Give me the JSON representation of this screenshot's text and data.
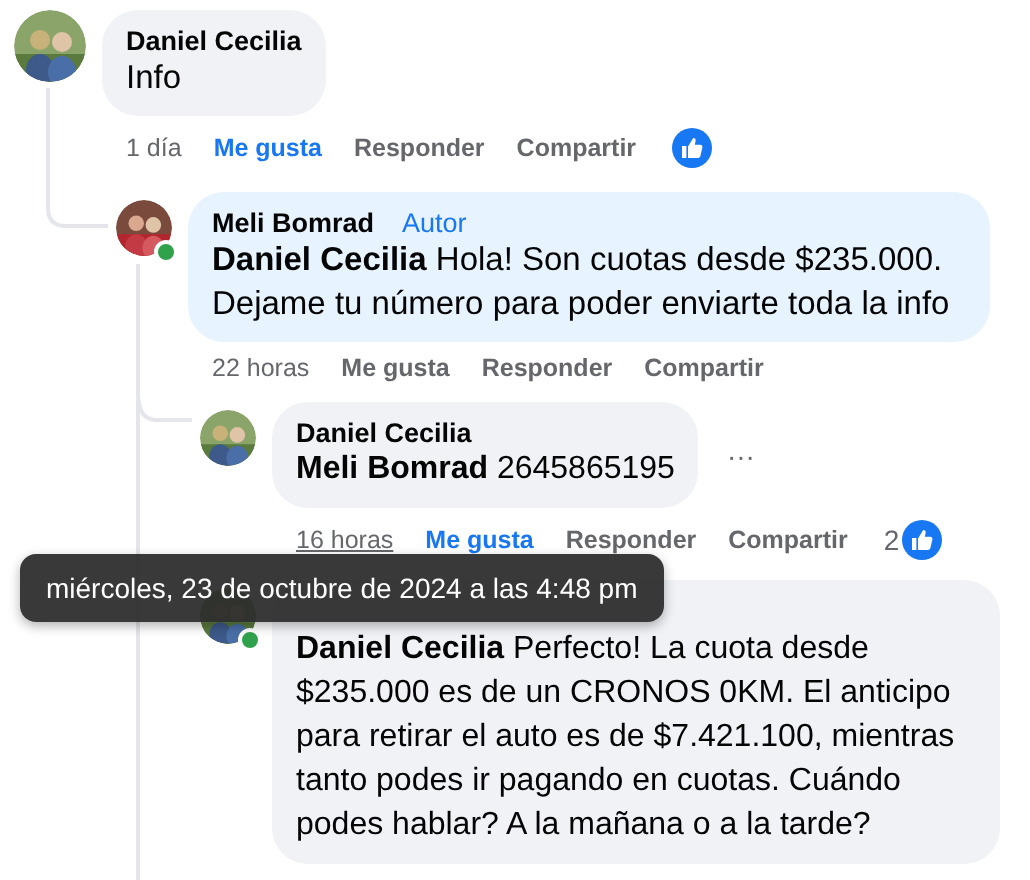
{
  "comments": [
    {
      "author": "Daniel Cecilia",
      "text": "Info",
      "time": "1 día",
      "time_hovered": false,
      "like": "Me gusta",
      "liked": true,
      "reply": "Responder",
      "share": "Compartir",
      "reaction": true,
      "online": false,
      "replies": [
        {
          "author": "Meli Bomrad",
          "badge": "Autor",
          "online": true,
          "text": "**Daniel Cecilia** Hola! Son cuotas desde $235.000. Dejame tu número para poder enviarte toda la info",
          "time": "22 horas",
          "time_hovered": false,
          "like": "Me gusta",
          "liked": false,
          "reply": "Responder",
          "share": "Compartir",
          "reaction": false,
          "replies": [
            {
              "author": "Daniel Cecilia",
              "online": false,
              "text": "**Meli Bomrad** 2645865195",
              "time": "16 horas",
              "time_hovered": true,
              "like": "Me gusta",
              "liked": true,
              "reply": "Responder",
              "share": "Compartir",
              "reaction_count": "2",
              "reaction": true,
              "more_menu": "···"
            },
            {
              "online": true,
              "text": "**Daniel Cecilia** Perfecto! La cuota desde $235.000 es de un CRONOS 0KM. El anticipo para retirar el auto es de $7.421.100, mientras tanto podes ir pagando en cuotas. Cuándo podes hablar? A la mañana o a la tarde?"
            }
          ]
        }
      ]
    }
  ],
  "tooltip": "miércoles, 23 de octubre de 2024 a las 4:48 pm"
}
